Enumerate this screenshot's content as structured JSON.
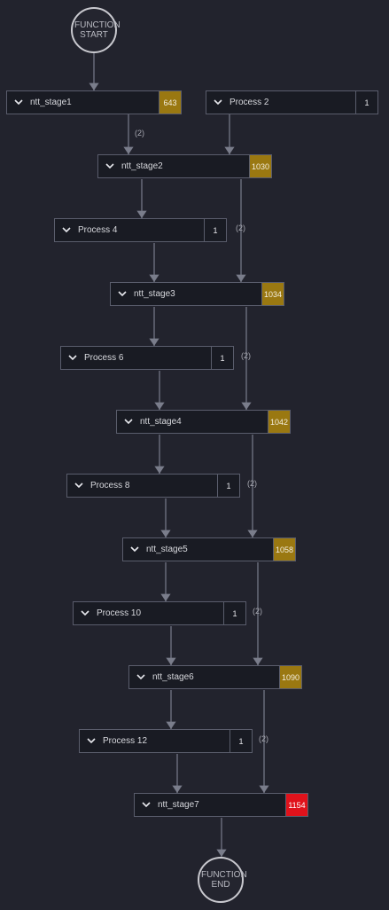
{
  "terminals": {
    "start_label": "FUNCTION START",
    "end_label": "FUNCTION END"
  },
  "nodes": [
    {
      "id": "ntt_stage1",
      "label": "ntt_stage1",
      "value": "643",
      "tone": "gold"
    },
    {
      "id": "process2",
      "label": "Process 2",
      "value": "1",
      "tone": "plain"
    },
    {
      "id": "ntt_stage2",
      "label": "ntt_stage2",
      "value": "1030",
      "tone": "gold"
    },
    {
      "id": "process4",
      "label": "Process 4",
      "value": "1",
      "tone": "plain"
    },
    {
      "id": "ntt_stage3",
      "label": "ntt_stage3",
      "value": "1034",
      "tone": "gold"
    },
    {
      "id": "process6",
      "label": "Process 6",
      "value": "1",
      "tone": "plain"
    },
    {
      "id": "ntt_stage4",
      "label": "ntt_stage4",
      "value": "1042",
      "tone": "gold"
    },
    {
      "id": "process8",
      "label": "Process 8",
      "value": "1",
      "tone": "plain"
    },
    {
      "id": "ntt_stage5",
      "label": "ntt_stage5",
      "value": "1058",
      "tone": "gold"
    },
    {
      "id": "process10",
      "label": "Process 10",
      "value": "1",
      "tone": "plain"
    },
    {
      "id": "ntt_stage6",
      "label": "ntt_stage6",
      "value": "1090",
      "tone": "gold"
    },
    {
      "id": "process12",
      "label": "Process 12",
      "value": "1",
      "tone": "plain"
    },
    {
      "id": "ntt_stage7",
      "label": "ntt_stage7",
      "value": "1154",
      "tone": "red"
    }
  ],
  "edge_labels": [
    "(2)",
    "(2)",
    "(2)",
    "(2)",
    "(2)",
    "(2)"
  ],
  "colors": {
    "background": "#22232d",
    "edge": "#6d707e",
    "gold_badge": "#9a7811",
    "red_badge": "#e0121b",
    "node_border": "#5a5d6c"
  }
}
